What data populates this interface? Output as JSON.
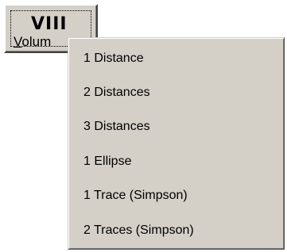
{
  "tool_button": {
    "icon_glyph": "VIII",
    "icon_name": "volume-measurement-icon",
    "label_mnemonic": "V",
    "label_rest": "olum"
  },
  "menu": {
    "items": [
      {
        "label": "1 Distance"
      },
      {
        "label": "2 Distances"
      },
      {
        "label": "3 Distances"
      },
      {
        "label": "1 Ellipse"
      },
      {
        "label": "1 Trace (Simpson)"
      },
      {
        "label": "2 Traces (Simpson)"
      }
    ]
  },
  "colors": {
    "face": "#d4d0c8",
    "highlight": "#ffffff",
    "shadow": "#808080",
    "dark_shadow": "#404040",
    "text": "#000000"
  }
}
